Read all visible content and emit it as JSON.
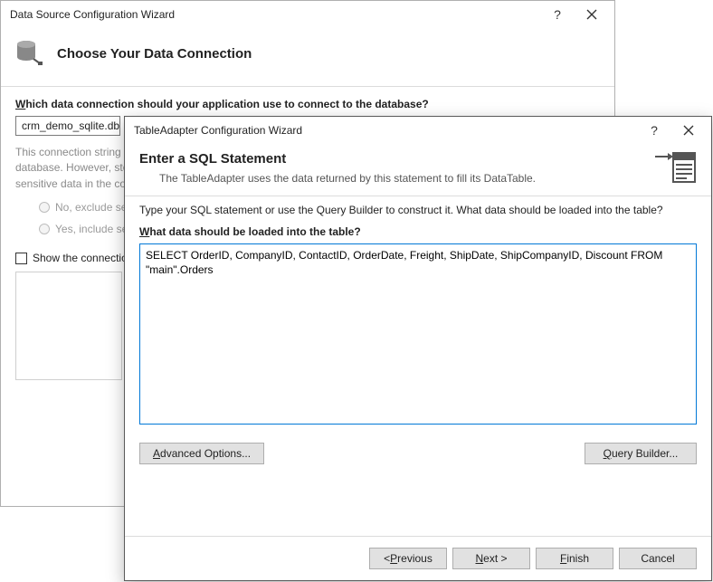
{
  "back": {
    "title": "Data Source Configuration Wizard",
    "heading": "Choose Your Data Connection",
    "question_prefix": "W",
    "question_suffix": "hich data connection should your application use to connect to the database?",
    "combo_value": "crm_demo_sqlite.db",
    "hint_text": "This connection string appears to contain sensitive data (for example, a password), which is required to connect to the database. However, storing sensitive data in the connection string can be a security risk. Do you want to include this sensitive data in the connection string?",
    "radio_no": "No, exclude sensitive data from the connection string. I will set this information in my application code.",
    "radio_yes": "Yes, include sensitive data in the connection string.",
    "show_conn": "Show the connection string that you will save in the application"
  },
  "front": {
    "title": "TableAdapter Configuration Wizard",
    "heading": "Enter a SQL Statement",
    "subtitle": "The TableAdapter uses the data returned by this statement to fill its DataTable.",
    "instruction": "Type your SQL statement or use the Query Builder to construct it. What data should be loaded into the table?",
    "question_prefix": "W",
    "question_suffix": "hat data should be loaded into the table?",
    "sql_text": "SELECT OrderID, CompanyID, ContactID, OrderDate, Freight, ShipDate, ShipCompanyID, Discount FROM \"main\".Orders",
    "buttons": {
      "advanced": "Advanced Options...",
      "query_builder": "Query Builder...",
      "previous": "< Previous",
      "next": "Next >",
      "finish": "Finish",
      "cancel": "Cancel"
    }
  }
}
